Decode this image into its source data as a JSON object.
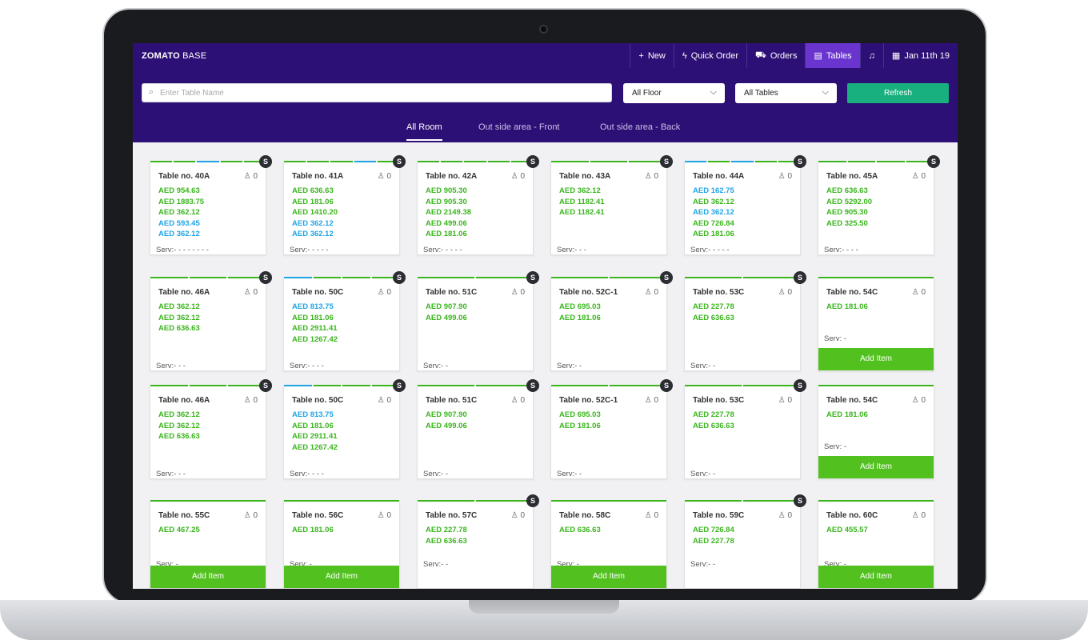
{
  "app": {
    "brand_bold": "ZOMATO",
    "brand_rest": " BASE"
  },
  "nav": {
    "new": "New",
    "quick_order": "Quick Order",
    "orders": "Orders",
    "tables": "Tables",
    "date": "Jan 11th 19"
  },
  "filters": {
    "search_placeholder": "Enter Table Name",
    "floor": "All Floor",
    "tables": "All Tables",
    "refresh": "Refresh"
  },
  "room_tabs": [
    "All Room",
    "Out side area - Front",
    "Out side area - Back"
  ],
  "colors": {
    "nav_bg": "#2d1075",
    "active_tab": "#6a34cf",
    "refresh": "#18b07e",
    "add_item": "#52c11f",
    "amount_green": "#3ab51d",
    "amount_blue": "#1fa4e6",
    "badge": "#2b2d33"
  },
  "badge_label": "S",
  "add_item_label": "Add Item",
  "cards": [
    {
      "title": "Table no. 40A",
      "guests": "0",
      "badge": true,
      "segs": [
        "g",
        "g",
        "b",
        "g",
        "g"
      ],
      "amounts": [
        [
          "AED 954.63",
          "green"
        ],
        [
          "AED 1883.75",
          "green"
        ],
        [
          "AED 362.12",
          "green"
        ],
        [
          "AED 593.45",
          "blue"
        ],
        [
          "AED 362.12",
          "blue"
        ]
      ],
      "serv": "Serv:- - - - - - - -",
      "add": false
    },
    {
      "title": "Table no. 41A",
      "guests": "0",
      "badge": true,
      "segs": [
        "g",
        "g",
        "g",
        "b",
        "g"
      ],
      "amounts": [
        [
          "AED 636.63",
          "green"
        ],
        [
          "AED 181.06",
          "green"
        ],
        [
          "AED 1410.20",
          "green"
        ],
        [
          "AED 362.12",
          "blue"
        ],
        [
          "AED 362.12",
          "blue"
        ]
      ],
      "serv": "Serv:- - - - -",
      "add": false
    },
    {
      "title": "Table no. 42A",
      "guests": "0",
      "badge": true,
      "segs": [
        "g",
        "g",
        "g",
        "g",
        "g"
      ],
      "amounts": [
        [
          "AED 905.30",
          "green"
        ],
        [
          "AED 905.30",
          "green"
        ],
        [
          "AED 2149.38",
          "green"
        ],
        [
          "AED 499.06",
          "green"
        ],
        [
          "AED 181.06",
          "green"
        ]
      ],
      "serv": "Serv:- - - - -",
      "add": false
    },
    {
      "title": "Table no. 43A",
      "guests": "0",
      "badge": true,
      "segs": [
        "g",
        "g",
        "g"
      ],
      "amounts": [
        [
          "AED 362.12",
          "green"
        ],
        [
          "AED 1182.41",
          "green"
        ],
        [
          "AED 1182.41",
          "green"
        ]
      ],
      "serv": "Serv:- - -",
      "add": false
    },
    {
      "title": "Table no. 44A",
      "guests": "0",
      "badge": true,
      "segs": [
        "b",
        "g",
        "b",
        "g",
        "g"
      ],
      "amounts": [
        [
          "AED 162.75",
          "blue"
        ],
        [
          "AED 362.12",
          "green"
        ],
        [
          "AED 362.12",
          "blue"
        ],
        [
          "AED 726.84",
          "green"
        ],
        [
          "AED 181.06",
          "green"
        ]
      ],
      "serv": "Serv:- - - - -",
      "add": false
    },
    {
      "title": "Table no. 45A",
      "guests": "0",
      "badge": true,
      "segs": [
        "g",
        "g",
        "g",
        "g"
      ],
      "amounts": [
        [
          "AED 636.63",
          "green"
        ],
        [
          "AED 5292.00",
          "green"
        ],
        [
          "AED 905.30",
          "green"
        ],
        [
          "AED 325.50",
          "green"
        ]
      ],
      "serv": "Serv:- - - -",
      "add": false
    },
    {
      "title": "Table no. 46A",
      "guests": "0",
      "badge": true,
      "segs": [
        "g",
        "g",
        "g"
      ],
      "amounts": [
        [
          "AED 362.12",
          "green"
        ],
        [
          "AED 362.12",
          "green"
        ],
        [
          "AED 636.63",
          "green"
        ]
      ],
      "serv": "Serv:- - -",
      "add": false
    },
    {
      "title": "Table no. 50C",
      "guests": "0",
      "badge": true,
      "segs": [
        "b",
        "g",
        "g",
        "g"
      ],
      "amounts": [
        [
          "AED 813.75",
          "blue"
        ],
        [
          "AED 181.06",
          "green"
        ],
        [
          "AED 2911.41",
          "green"
        ],
        [
          "AED 1267.42",
          "green"
        ]
      ],
      "serv": "Serv:- - - -",
      "add": false
    },
    {
      "title": "Table no. 51C",
      "guests": "0",
      "badge": true,
      "segs": [
        "g",
        "g"
      ],
      "amounts": [
        [
          "AED 907.90",
          "green"
        ],
        [
          "AED 499.06",
          "green"
        ]
      ],
      "serv": "Serv:- -",
      "add": false
    },
    {
      "title": "Table no. 52C-1",
      "guests": "0",
      "badge": true,
      "segs": [
        "g",
        "g"
      ],
      "amounts": [
        [
          "AED 695.03",
          "green"
        ],
        [
          "AED 181.06",
          "green"
        ]
      ],
      "serv": "Serv:- -",
      "add": false
    },
    {
      "title": "Table no. 53C",
      "guests": "0",
      "badge": true,
      "segs": [
        "g",
        "g"
      ],
      "amounts": [
        [
          "AED 227.78",
          "green"
        ],
        [
          "AED 636.63",
          "green"
        ]
      ],
      "serv": "Serv:- -",
      "add": false
    },
    {
      "title": "Table no. 54C",
      "guests": "0",
      "badge": false,
      "segs": [
        "g"
      ],
      "amounts": [
        [
          "AED 181.06",
          "green"
        ]
      ],
      "serv": "Serv: -",
      "add": true
    },
    {
      "title": "Table no. 46A",
      "guests": "0",
      "badge": true,
      "segs": [
        "g",
        "g",
        "g"
      ],
      "amounts": [
        [
          "AED 362.12",
          "green"
        ],
        [
          "AED 362.12",
          "green"
        ],
        [
          "AED 636.63",
          "green"
        ]
      ],
      "serv": "Serv:- - -",
      "add": false
    },
    {
      "title": "Table no. 50C",
      "guests": "0",
      "badge": true,
      "segs": [
        "b",
        "g",
        "g",
        "g"
      ],
      "amounts": [
        [
          "AED 813.75",
          "blue"
        ],
        [
          "AED 181.06",
          "green"
        ],
        [
          "AED 2911.41",
          "green"
        ],
        [
          "AED 1267.42",
          "green"
        ]
      ],
      "serv": "Serv:- - - -",
      "add": false
    },
    {
      "title": "Table no. 51C",
      "guests": "0",
      "badge": true,
      "segs": [
        "g",
        "g"
      ],
      "amounts": [
        [
          "AED 907.90",
          "green"
        ],
        [
          "AED 499.06",
          "green"
        ]
      ],
      "serv": "Serv:- -",
      "add": false
    },
    {
      "title": "Table no. 52C-1",
      "guests": "0",
      "badge": true,
      "segs": [
        "g",
        "g"
      ],
      "amounts": [
        [
          "AED 695.03",
          "green"
        ],
        [
          "AED 181.06",
          "green"
        ]
      ],
      "serv": "Serv:- -",
      "add": false
    },
    {
      "title": "Table no. 53C",
      "guests": "0",
      "badge": true,
      "segs": [
        "g",
        "g"
      ],
      "amounts": [
        [
          "AED 227.78",
          "green"
        ],
        [
          "AED 636.63",
          "green"
        ]
      ],
      "serv": "Serv:- -",
      "add": false
    },
    {
      "title": "Table no. 54C",
      "guests": "0",
      "badge": false,
      "segs": [
        "g"
      ],
      "amounts": [
        [
          "AED 181.06",
          "green"
        ]
      ],
      "serv": "Serv: -",
      "add": true
    },
    {
      "title": "Table no. 55C",
      "guests": "0",
      "badge": false,
      "segs": [
        "g"
      ],
      "amounts": [
        [
          "AED 467.25",
          "green"
        ]
      ],
      "serv": "Serv: -",
      "add": true
    },
    {
      "title": "Table no. 56C",
      "guests": "0",
      "badge": false,
      "segs": [
        "g"
      ],
      "amounts": [
        [
          "AED 181.06",
          "green"
        ]
      ],
      "serv": "Serv: -",
      "add": true
    },
    {
      "title": "Table no. 57C",
      "guests": "0",
      "badge": true,
      "segs": [
        "g",
        "g"
      ],
      "amounts": [
        [
          "AED 227.78",
          "green"
        ],
        [
          "AED 636.63",
          "green"
        ]
      ],
      "serv": "Serv:- -",
      "add": false
    },
    {
      "title": "Table no. 58C",
      "guests": "0",
      "badge": false,
      "segs": [
        "g"
      ],
      "amounts": [
        [
          "AED 636.63",
          "green"
        ]
      ],
      "serv": "Serv: -",
      "add": true
    },
    {
      "title": "Table no. 59C",
      "guests": "0",
      "badge": true,
      "segs": [
        "g",
        "g"
      ],
      "amounts": [
        [
          "AED 726.84",
          "green"
        ],
        [
          "AED 227.78",
          "green"
        ]
      ],
      "serv": "Serv:- -",
      "add": false
    },
    {
      "title": "Table no. 60C",
      "guests": "0",
      "badge": false,
      "segs": [
        "g"
      ],
      "amounts": [
        [
          "AED 455.57",
          "green"
        ]
      ],
      "serv": "Serv: -",
      "add": true
    }
  ]
}
